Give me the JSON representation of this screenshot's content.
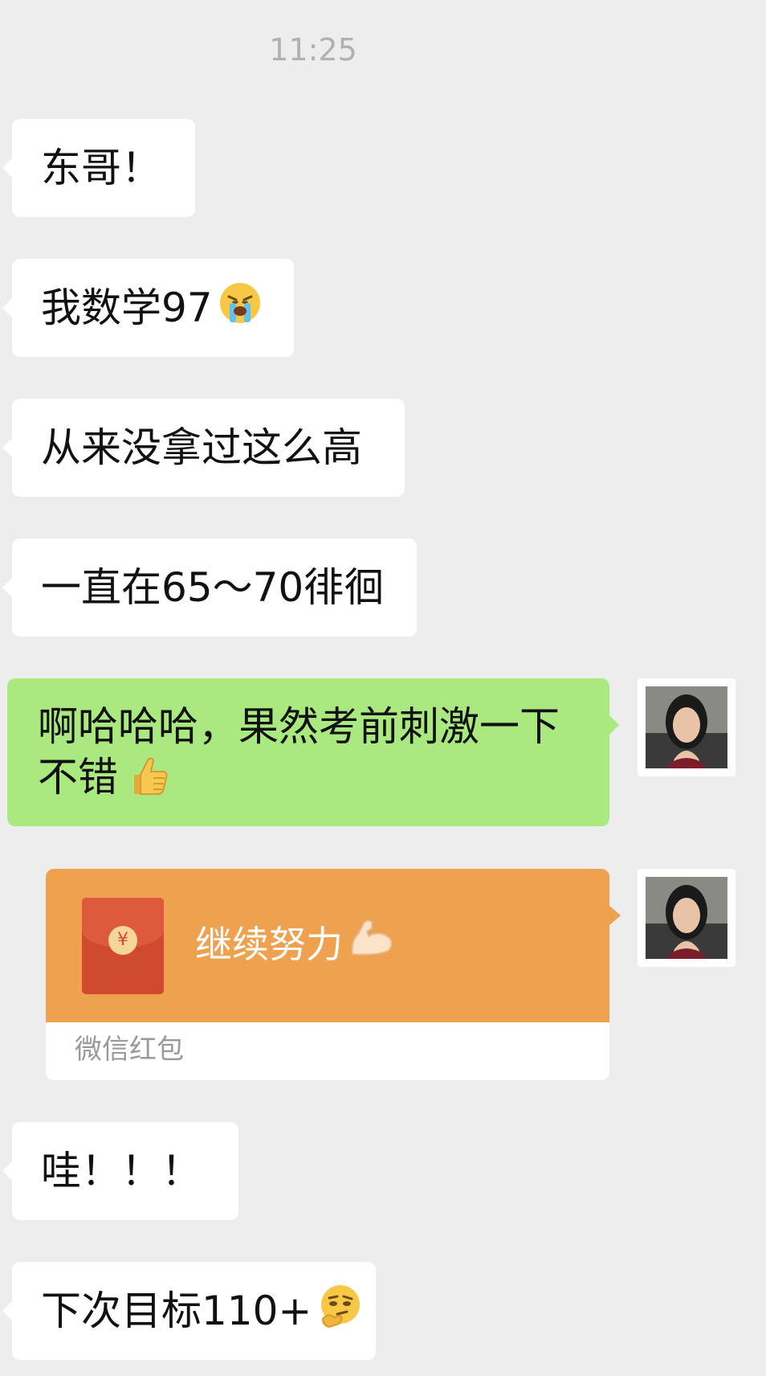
{
  "timestamp": "11:25",
  "messages": [
    {
      "text": "东哥！"
    },
    {
      "text": "我数学97",
      "emoji": "loudly-crying-face"
    },
    {
      "text": "从来没拿过这么高"
    },
    {
      "text": "一直在65～70徘徊"
    },
    {
      "text": "啊哈哈哈，果然考前刺激一下不错",
      "emoji": "thumbs-up"
    },
    {
      "text": "哇！！！"
    },
    {
      "text": "下次目标110+",
      "emoji": "smirking-face"
    }
  ],
  "red_packet": {
    "title": "继续努力",
    "emoji": "flexed-biceps",
    "coin_symbol": "¥",
    "label": "微信红包"
  },
  "colors": {
    "background": "#ededed",
    "incoming_bubble": "#ffffff",
    "outgoing_bubble": "#a9e97f",
    "red_packet": "#eea14f"
  }
}
